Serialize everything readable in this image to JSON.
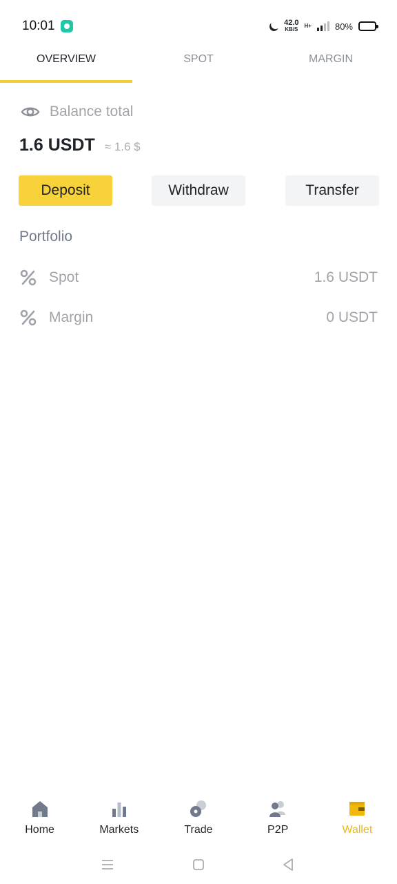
{
  "status_bar": {
    "time": "10:01",
    "net_speed_value": "42.0",
    "net_speed_unit": "KB/S",
    "network_type": "H+",
    "battery": "80%"
  },
  "tabs": [
    {
      "label": "OVERVIEW",
      "active": true
    },
    {
      "label": "SPOT",
      "active": false
    },
    {
      "label": "MARGIN",
      "active": false
    }
  ],
  "balance": {
    "label": "Balance total",
    "amount": "1.6 USDT",
    "approx": "≈ 1.6 $"
  },
  "actions": {
    "deposit": "Deposit",
    "withdraw": "Withdraw",
    "transfer": "Transfer"
  },
  "portfolio": {
    "title": "Portfolio",
    "rows": [
      {
        "name": "Spot",
        "value": "1.6 USDT",
        "icon": "percent-icon"
      },
      {
        "name": "Margin",
        "value": "0 USDT",
        "icon": "percent-icon"
      }
    ]
  },
  "bottom_nav": [
    {
      "label": "Home",
      "icon": "home-icon",
      "active": false
    },
    {
      "label": "Markets",
      "icon": "markets-icon",
      "active": false
    },
    {
      "label": "Trade",
      "icon": "trade-icon",
      "active": false
    },
    {
      "label": "P2P",
      "icon": "p2p-icon",
      "active": false
    },
    {
      "label": "Wallet",
      "icon": "wallet-icon",
      "active": true
    }
  ],
  "colors": {
    "accent": "#f0b90b",
    "deposit_button": "#f7d23a",
    "secondary_button": "#f3f4f5",
    "muted_text": "#a0a4aa"
  }
}
